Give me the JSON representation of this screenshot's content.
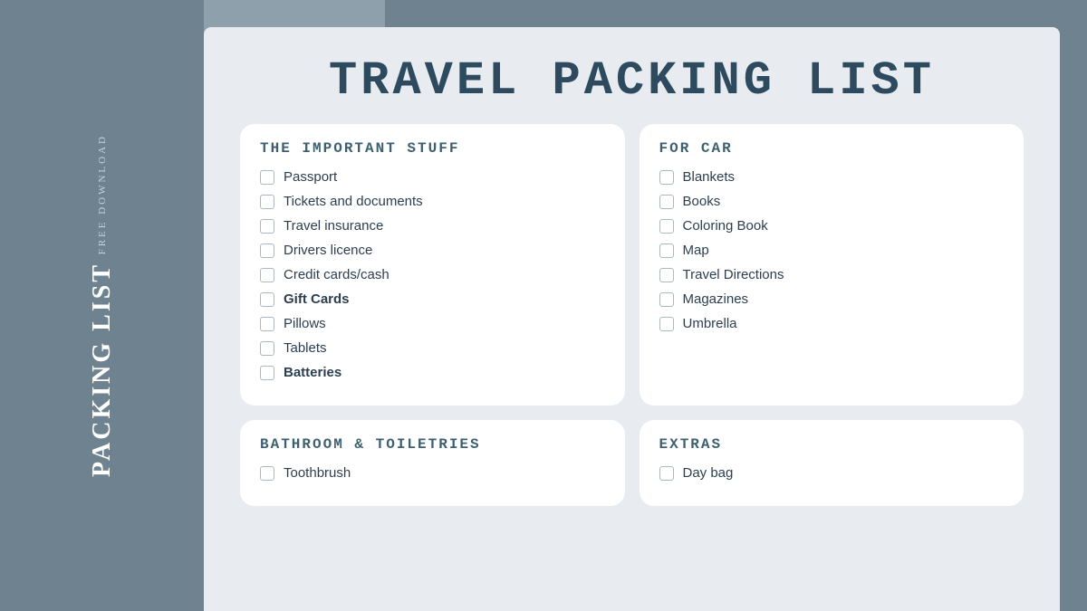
{
  "sidebar": {
    "free_download": "FREE DOWNLOAD",
    "packing_list": "PACKING LIST"
  },
  "page": {
    "title": "TRAVEL PACKING LIST"
  },
  "sections": [
    {
      "id": "important-stuff",
      "title": "THE IMPORTANT STUFF",
      "items": [
        "Passport",
        "Tickets and documents",
        "Travel insurance",
        "Drivers licence",
        "Credit cards/cash",
        "Gift Cards",
        "Pillows",
        "Tablets",
        "Batteries"
      ]
    },
    {
      "id": "for-car",
      "title": "FOR CAR",
      "items": [
        "Blankets",
        "Books",
        "Coloring Book",
        "Map",
        "Travel Directions",
        "Magazines",
        "Umbrella"
      ]
    },
    {
      "id": "bathroom",
      "title": "BATHROOM & TOILETRIES",
      "items": [
        "Toothbrush"
      ]
    },
    {
      "id": "extras",
      "title": "EXTRAS",
      "items": [
        "Day bag"
      ]
    }
  ]
}
